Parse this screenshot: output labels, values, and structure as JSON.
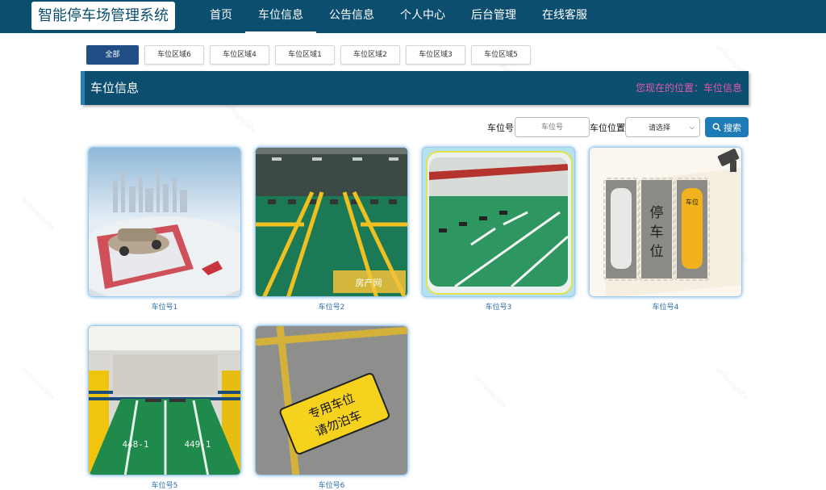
{
  "header": {
    "logo": "智能停车场管理系统",
    "nav": [
      {
        "label": "首页"
      },
      {
        "label": "车位信息",
        "active": true
      },
      {
        "label": "公告信息"
      },
      {
        "label": "个人中心"
      },
      {
        "label": "后台管理"
      },
      {
        "label": "在线客服"
      }
    ]
  },
  "tabs": [
    {
      "label": "全部",
      "active": true
    },
    {
      "label": "车位区域6"
    },
    {
      "label": "车位区域4"
    },
    {
      "label": "车位区域1"
    },
    {
      "label": "车位区域2"
    },
    {
      "label": "车位区域3"
    },
    {
      "label": "车位区域5"
    }
  ],
  "banner": {
    "title": "车位信息",
    "location": "您现在的位置：车位信息"
  },
  "search": {
    "number_label": "车位号",
    "number_placeholder": "车位号",
    "position_label": "车位位置",
    "position_value": "请选择",
    "button_label": "搜索"
  },
  "cards": [
    {
      "name": "车位号1"
    },
    {
      "name": "车位号2",
      "overlay_text": "房产网"
    },
    {
      "name": "车位号3"
    },
    {
      "name": "车位号4",
      "sign_left": "停车位",
      "sign_right": "车位"
    },
    {
      "name": "车位号5",
      "floor_left": "448-1",
      "floor_right": "449-1"
    },
    {
      "name": "车位号6",
      "sign_line1": "专用车位",
      "sign_line2": "请勿泊车"
    }
  ],
  "colors": {
    "nav_bg": "#0c4e70",
    "tab_active": "#214f85",
    "location_text": "#e05aa8",
    "search_button": "#1f7bb6"
  }
}
